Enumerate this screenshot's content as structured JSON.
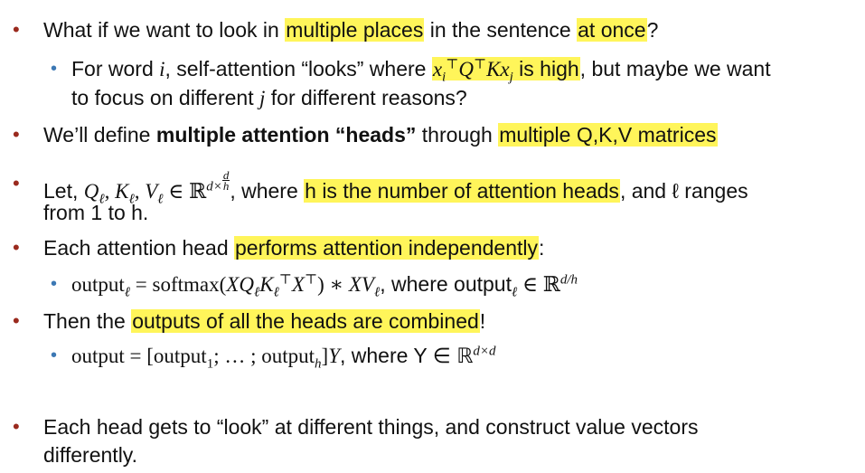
{
  "bullets": [
    {
      "pre": "What if we want to look in ",
      "hl1": "multiple places",
      "mid": " in the sentence ",
      "hl2": "at once",
      "post": "?"
    },
    {
      "pre": "For word ",
      "var_i": "i",
      "mid": ", self-attention “looks” where ",
      "hl_math": "x",
      "hl_rest": " is high",
      "post": ", but maybe we want"
    },
    {
      "line2_pre": "to focus on different ",
      "var_j": "j",
      "line2_post": " for different reasons?"
    },
    {
      "pre": "We’ll define ",
      "bold": "multiple attention “heads”",
      "mid": " through ",
      "hl": "multiple Q,K,V matrices"
    },
    {
      "pre": "Let, ",
      "math": "Q",
      "mid": ", where ",
      "hl": "h is the number of attention heads",
      "post": ", and ℓ ranges",
      "line2": "from 1 to h."
    },
    {
      "pre": "Each attention head ",
      "hl": "performs attention independently",
      "post": ":"
    },
    {
      "math_text": "output",
      "post": ", where  output"
    },
    {
      "pre": "Then the ",
      "hl": "outputs of all the heads are combined",
      "post": "!"
    },
    {
      "math_text": "output",
      "post": ", where Y ∈ ℝ"
    },
    {
      "line1": "Each head gets to “look” at different things, and construct value vectors",
      "line2": "differently."
    }
  ],
  "colors": {
    "highlight": "#fff55a",
    "bullet_primary": "#9a2a1e",
    "bullet_secondary": "#3c78b4"
  }
}
